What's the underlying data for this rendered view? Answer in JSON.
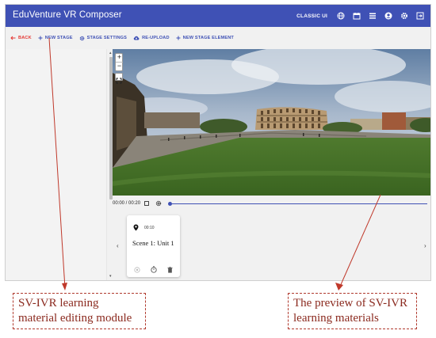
{
  "app": {
    "title": "EduVenture VR Composer",
    "classic_ui_label": "CLASSIC UI",
    "header_icons": [
      "globe-icon",
      "calendar-icon",
      "list-icon",
      "account-icon",
      "gear-icon",
      "exit-icon"
    ]
  },
  "toolbar": {
    "back": "BACK",
    "new_stage": "NEW STAGE",
    "stage_settings": "STAGE SETTINGS",
    "re_upload": "RE-UPLOAD",
    "new_stage_element": "NEW STAGE ELEMENT"
  },
  "map_controls": {
    "zoom_in": "+",
    "zoom_out": "−"
  },
  "player": {
    "time": "00:00 / 00:20",
    "progress": 0.0
  },
  "scene_card": {
    "time": "00:10",
    "title": "Scene 1: Unit 1"
  },
  "annotations": {
    "left": "SV-IVR learning material editing module",
    "right": "The preview of SV-IVR learning materials"
  },
  "colors": {
    "brand": "#3f51b5",
    "back": "#e53935",
    "annotation": "#b03a2e"
  }
}
